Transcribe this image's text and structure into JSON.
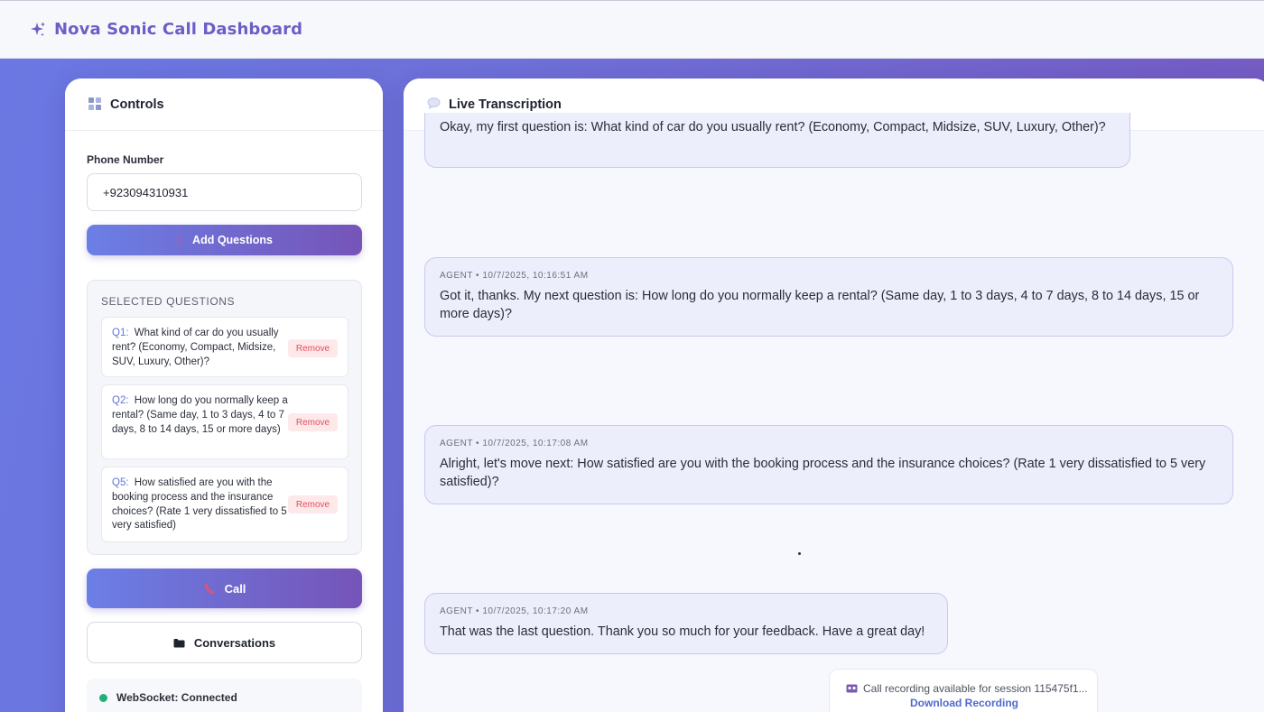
{
  "app": {
    "title": "Nova Sonic Call Dashboard",
    "brand_color": "#6a5fc6"
  },
  "controls": {
    "title": "Controls",
    "phone_label": "Phone Number",
    "phone_value": "+923094310931",
    "add_questions_label": "Add Questions",
    "selected_title": "SELECTED QUESTIONS",
    "questions": [
      {
        "num": "Q1:",
        "text": "What kind of car do you usually rent? (Economy, Compact, Midsize, SUV, Luxury, Other)?",
        "remove": "Remove"
      },
      {
        "num": "Q2:",
        "text": "How long do you normally keep a rental? (Same day, 1 to 3 days, 4 to 7 days, 8 to 14 days, 15 or more days)",
        "remove": "Remove"
      },
      {
        "num": "Q5:",
        "text": "How satisfied are you with the booking process and the insurance choices? (Rate 1 very dissatisfied to 5 very satisfied)",
        "remove": "Remove"
      }
    ],
    "call_label": "Call",
    "conversations_label": "Conversations",
    "websocket_status": "WebSocket: Connected",
    "status_color": "#22b07a"
  },
  "transcription": {
    "title": "Live Transcription",
    "messages": [
      {
        "meta": "",
        "text": "Okay, my first question is: What kind of car do you usually rent? (Economy, Compact, Midsize, SUV, Luxury, Other)?"
      },
      {
        "meta": "AGENT • 10/7/2025, 10:16:51 AM",
        "text": "Got it, thanks. My next question is: How long do you normally keep a rental? (Same day, 1 to 3 days, 4 to 7 days, 8 to 14 days, 15 or more days)?"
      },
      {
        "meta": "AGENT • 10/7/2025, 10:17:08 AM",
        "text": "Alright, let's move next: How satisfied are you with the booking process and the insurance choices? (Rate 1 very dissatisfied to 5 very satisfied)?"
      },
      {
        "meta": "AGENT • 10/7/2025, 10:17:20 AM",
        "text": "That was the last question. Thank you so much for your feedback. Have a great day!"
      }
    ],
    "recording_text": "Call recording available for session 115475f1...",
    "recording_link": "Download Recording"
  }
}
